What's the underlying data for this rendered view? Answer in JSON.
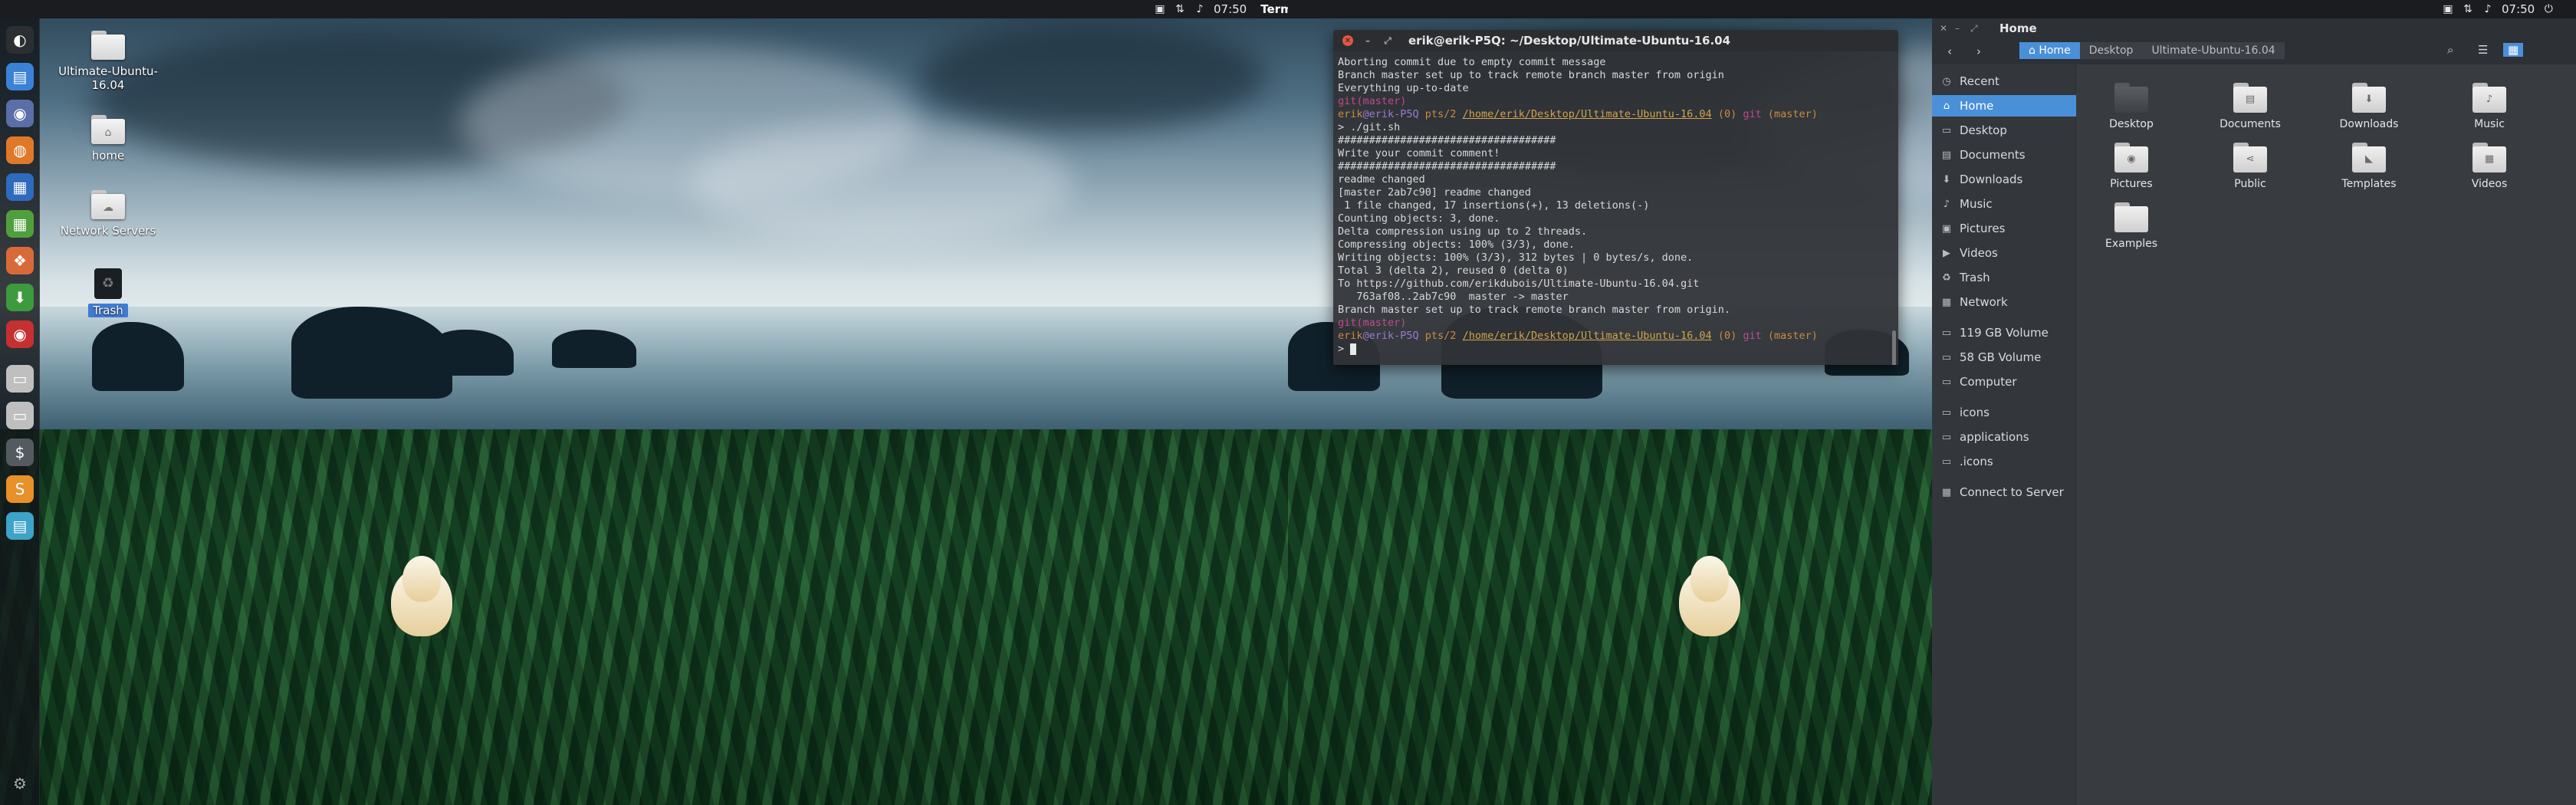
{
  "top_panel": {
    "left": {
      "clock": "07:50",
      "active_app": "Terminal"
    },
    "right": {
      "clock": "07:50"
    }
  },
  "launcher": {
    "items": [
      {
        "name": "dash-icon",
        "glyph": "◐",
        "color": "#2b2f34"
      },
      {
        "name": "files-icon",
        "glyph": "▤",
        "color": "#3b82d6"
      },
      {
        "name": "system-monitor-icon",
        "glyph": "◉",
        "color": "#5a6ea8"
      },
      {
        "name": "firefox-icon",
        "glyph": "◍",
        "color": "#e0782a"
      },
      {
        "name": "writer-icon",
        "glyph": "▦",
        "color": "#2f6bbd"
      },
      {
        "name": "calc-icon",
        "glyph": "▦",
        "color": "#4fa03c"
      },
      {
        "name": "ubuntu-tweak-icon",
        "glyph": "❖",
        "color": "#d86a3a"
      },
      {
        "name": "software-center-icon",
        "glyph": "⬇",
        "color": "#3d9a3d"
      },
      {
        "name": "screen-recorder-icon",
        "glyph": "◉",
        "color": "#c53030"
      },
      {
        "name": "drive-icon",
        "glyph": "▭",
        "color": "#bfbfbf"
      },
      {
        "name": "drive-icon-2",
        "glyph": "▭",
        "color": "#bfbfbf"
      },
      {
        "name": "dollar-app-icon",
        "glyph": "$",
        "color": "#555a60"
      },
      {
        "name": "sublime-icon",
        "glyph": "S",
        "color": "#e8902a"
      },
      {
        "name": "notes-icon",
        "glyph": "▤",
        "color": "#3da3c8"
      }
    ],
    "bottom_glyph": "⚙"
  },
  "desktop": {
    "icons": [
      {
        "label": "Ultimate-Ubuntu-16.04",
        "glyph": ""
      },
      {
        "label": "home",
        "glyph": "⌂"
      },
      {
        "label": "Network Servers",
        "glyph": "☁"
      },
      {
        "label": "Trash",
        "glyph": "♻"
      }
    ]
  },
  "terminal": {
    "title": "erik@erik-P5Q: ~/Desktop/Ultimate-Ubuntu-16.04",
    "lines_before": [
      "Aborting commit due to empty commit message",
      "Branch master set up to track remote branch master from origin",
      "Everything up-to-date"
    ],
    "git_branch_line": "git(master)",
    "prompt": {
      "user": "erik",
      "host": "@erik-P5Q",
      "tty": " pts/2 ",
      "dir": "/home/erik/Desktop/Ultimate-Ubuntu-16.04",
      "status": " (0) ",
      "git": "git",
      "branch": " (master)"
    },
    "command": "> ./git.sh",
    "output": [
      "###################################",
      "Write your commit comment!",
      "###################################",
      "readme changed",
      "[master 2ab7c90] readme changed",
      " 1 file changed, 17 insertions(+), 13 deletions(-)",
      "Counting objects: 3, done.",
      "Delta compression using up to 2 threads.",
      "Compressing objects: 100% (3/3), done.",
      "Writing objects: 100% (3/3), 312 bytes | 0 bytes/s, done.",
      "Total 3 (delta 2), reused 0 (delta 0)",
      "To https://github.com/erikdubois/Ultimate-Ubuntu-16.04.git",
      "   763af08..2ab7c90  master -> master",
      "Branch master set up to track remote branch master from origin."
    ],
    "final_prompt": "> "
  },
  "files": {
    "title": "Home",
    "breadcrumbs": [
      "Home",
      "Desktop",
      "Ultimate-Ubuntu-16.04"
    ],
    "sidebar": [
      {
        "label": "Recent",
        "icon": "recent-icon",
        "glyph": "◷"
      },
      {
        "label": "Home",
        "icon": "home-icon",
        "glyph": "⌂",
        "active": true
      },
      {
        "label": "Desktop",
        "icon": "desktop-icon",
        "glyph": "▭"
      },
      {
        "label": "Documents",
        "icon": "documents-icon",
        "glyph": "▤"
      },
      {
        "label": "Downloads",
        "icon": "downloads-icon",
        "glyph": "⬇"
      },
      {
        "label": "Music",
        "icon": "music-icon",
        "glyph": "♪"
      },
      {
        "label": "Pictures",
        "icon": "pictures-icon",
        "glyph": "▣"
      },
      {
        "label": "Videos",
        "icon": "videos-icon",
        "glyph": "▶"
      },
      {
        "label": "Trash",
        "icon": "trash-icon",
        "glyph": "♻"
      },
      {
        "label": "Network",
        "icon": "network-icon",
        "glyph": "▦"
      },
      {
        "label": "119 GB Volume",
        "icon": "volume-icon",
        "glyph": "▭"
      },
      {
        "label": "58 GB Volume",
        "icon": "volume-icon",
        "glyph": "▭"
      },
      {
        "label": "Computer",
        "icon": "computer-icon",
        "glyph": "▭"
      },
      {
        "label": "icons",
        "icon": "folder-icon",
        "glyph": "▭"
      },
      {
        "label": "applications",
        "icon": "folder-icon",
        "glyph": "▭"
      },
      {
        "label": ".icons",
        "icon": "folder-icon",
        "glyph": "▭"
      },
      {
        "label": "Connect to Server",
        "icon": "connect-server-icon",
        "glyph": "▦"
      }
    ],
    "items": [
      {
        "label": "Desktop",
        "glyph": "",
        "dark": true
      },
      {
        "label": "Documents",
        "glyph": "▤"
      },
      {
        "label": "Downloads",
        "glyph": "⬇"
      },
      {
        "label": "Music",
        "glyph": "♪"
      },
      {
        "label": "Pictures",
        "glyph": "◉"
      },
      {
        "label": "Public",
        "glyph": "⋖"
      },
      {
        "label": "Templates",
        "glyph": "◣"
      },
      {
        "label": "Videos",
        "glyph": "▦"
      },
      {
        "label": "Examples",
        "glyph": ""
      }
    ]
  }
}
